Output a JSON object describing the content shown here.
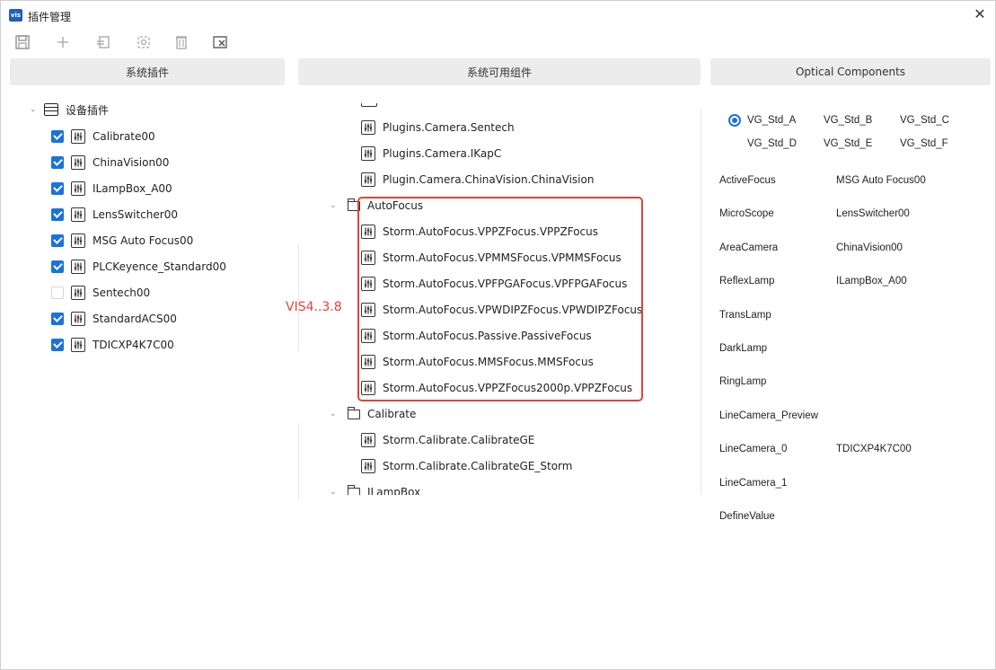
{
  "window": {
    "title": "插件管理",
    "app_logo": "vis"
  },
  "toolbar": {
    "buttons": [
      "save-icon",
      "add-icon",
      "import-icon",
      "config-icon",
      "delete-icon",
      "clear-icon"
    ]
  },
  "headers": {
    "left": "系统插件",
    "middle": "系统可用组件",
    "right": "Optical Components"
  },
  "left_tree": {
    "root": "设备插件",
    "items": [
      {
        "label": "Calibrate00",
        "checked": true
      },
      {
        "label": "ChinaVision00",
        "checked": true
      },
      {
        "label": "ILampBox_A00",
        "checked": true
      },
      {
        "label": "LensSwitcher00",
        "checked": true
      },
      {
        "label": "MSG Auto Focus00",
        "checked": true
      },
      {
        "label": "PLCKeyence_Standard00",
        "checked": true
      },
      {
        "label": "Sentech00",
        "checked": false
      },
      {
        "label": "StandardACS00",
        "checked": true
      },
      {
        "label": "TDICXP4K7C00",
        "checked": true
      }
    ]
  },
  "middle_tree": {
    "camera_items": [
      "Plugins.Camera.Sentech",
      "Plugins.Camera.IKapC",
      "Plugin.Camera.ChinaVision.ChinaVision"
    ],
    "autofocus_folder": "AutoFocus",
    "autofocus_items": [
      "Storm.AutoFocus.VPPZFocus.VPPZFocus",
      "Storm.AutoFocus.VPMMSFocus.VPMMSFocus",
      "Storm.AutoFocus.VPFPGAFocus.VPFPGAFocus",
      "Storm.AutoFocus.VPWDIPZFocus.VPWDIPZFocus",
      "Storm.AutoFocus.Passive.PassiveFocus",
      "Storm.AutoFocus.MMSFocus.MMSFocus",
      "Storm.AutoFocus.VPPZFocus2000p.VPPZFocus"
    ],
    "calibrate_folder": "Calibrate",
    "calibrate_items": [
      "Storm.Calibrate.CalibrateGE",
      "Storm.Calibrate.CalibrateGE_Storm"
    ],
    "lampbox_folder": "ILampBox"
  },
  "annotation": {
    "version": "VIS4..3.8"
  },
  "optical": {
    "presets": [
      "VG_Std_A",
      "VG_Std_B",
      "VG_Std_C",
      "VG_Std_D",
      "VG_Std_E",
      "VG_Std_F"
    ],
    "selected_preset": "VG_Std_A",
    "mappings": [
      {
        "name": "ActiveFocus",
        "value": "MSG Auto Focus00"
      },
      {
        "name": "MicroScope",
        "value": "LensSwitcher00"
      },
      {
        "name": "AreaCamera",
        "value": "ChinaVision00"
      },
      {
        "name": "ReflexLamp",
        "value": "ILampBox_A00"
      },
      {
        "name": "TransLamp",
        "value": ""
      },
      {
        "name": "DarkLamp",
        "value": ""
      },
      {
        "name": "RingLamp",
        "value": ""
      },
      {
        "name": "LineCamera_Preview",
        "value": ""
      },
      {
        "name": "LineCamera_0",
        "value": "TDICXP4K7C00"
      },
      {
        "name": "LineCamera_1",
        "value": ""
      },
      {
        "name": "DefineValue",
        "value": ""
      }
    ]
  },
  "colors": {
    "accent": "#1a73d9",
    "highlight": "#e0433c",
    "header_bg": "#ececec"
  }
}
